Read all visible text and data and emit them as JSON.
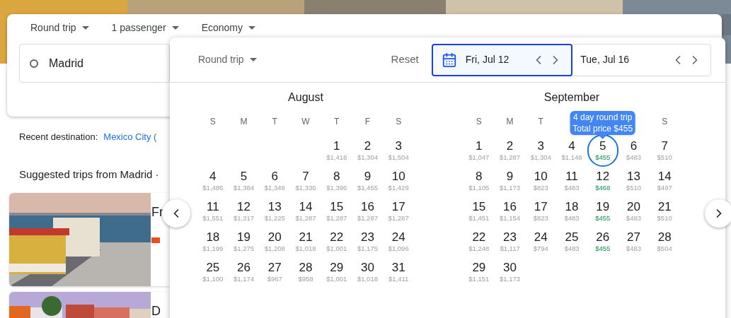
{
  "search_options": [
    {
      "label": "Round trip"
    },
    {
      "label": "1 passenger"
    },
    {
      "label": "Economy"
    }
  ],
  "origin": {
    "value": "Madrid"
  },
  "recent": {
    "label": "Recent destination:",
    "link": "Mexico City ("
  },
  "suggested_heading": "Suggested trips from Madrid ·",
  "trips": [
    {
      "title": "Fr",
      "kind": "picture"
    },
    {
      "title": "D",
      "kind": "picture"
    }
  ],
  "date_picker": {
    "trip_type": "Round trip",
    "reset": "Reset",
    "dates": [
      {
        "label": "Fri, Jul 12",
        "selected": true
      },
      {
        "label": "Tue, Jul 16",
        "selected": false
      }
    ],
    "months": [
      {
        "name": "August",
        "weekdays": [
          {
            "label": "S",
            "kind": "weekday"
          },
          {
            "label": "M",
            "kind": "weekday"
          },
          {
            "label": "T",
            "kind": "weekday"
          },
          {
            "label": "W",
            "kind": "weekday"
          },
          {
            "label": "T",
            "kind": "weekday"
          },
          {
            "label": "F",
            "kind": "weekday"
          },
          {
            "label": "S",
            "kind": "weekday"
          }
        ],
        "weeks": [
          {
            "kind": "first_week",
            "days": [
              {
                "day": "1",
                "price": "$1,418",
                "cheap": false,
                "selected": false
              },
              {
                "day": "2",
                "price": "$1,304",
                "cheap": false,
                "selected": false
              },
              {
                "day": "3",
                "price": "$1,504",
                "cheap": false,
                "selected": false
              }
            ]
          },
          {
            "kind": "week",
            "days": [
              {
                "day": "4",
                "price": "$1,486",
                "cheap": false,
                "selected": false
              },
              {
                "day": "5",
                "price": "$1,384",
                "cheap": false,
                "selected": false
              },
              {
                "day": "6",
                "price": "$1,348",
                "cheap": false,
                "selected": false
              },
              {
                "day": "7",
                "price": "$1,336",
                "cheap": false,
                "selected": false
              },
              {
                "day": "8",
                "price": "$1,396",
                "cheap": false,
                "selected": false
              },
              {
                "day": "9",
                "price": "$1,455",
                "cheap": false,
                "selected": false
              },
              {
                "day": "10",
                "price": "$1,429",
                "cheap": false,
                "selected": false
              }
            ]
          },
          {
            "kind": "week",
            "days": [
              {
                "day": "11",
                "price": "$1,551",
                "cheap": false,
                "selected": false
              },
              {
                "day": "12",
                "price": "$1,317",
                "cheap": false,
                "selected": false
              },
              {
                "day": "13",
                "price": "$1,225",
                "cheap": false,
                "selected": false
              },
              {
                "day": "14",
                "price": "$1,287",
                "cheap": false,
                "selected": false
              },
              {
                "day": "15",
                "price": "$1,287",
                "cheap": false,
                "selected": false
              },
              {
                "day": "16",
                "price": "$1,287",
                "cheap": false,
                "selected": false
              },
              {
                "day": "17",
                "price": "$1,287",
                "cheap": false,
                "selected": false
              }
            ]
          },
          {
            "kind": "week",
            "days": [
              {
                "day": "18",
                "price": "$1,199",
                "cheap": false,
                "selected": false
              },
              {
                "day": "19",
                "price": "$1,275",
                "cheap": false,
                "selected": false
              },
              {
                "day": "20",
                "price": "$1,208",
                "cheap": false,
                "selected": false
              },
              {
                "day": "21",
                "price": "$1,018",
                "cheap": false,
                "selected": false
              },
              {
                "day": "22",
                "price": "$1,001",
                "cheap": false,
                "selected": false
              },
              {
                "day": "23",
                "price": "$1,175",
                "cheap": false,
                "selected": false
              },
              {
                "day": "24",
                "price": "$1,096",
                "cheap": false,
                "selected": false
              }
            ]
          },
          {
            "kind": "week",
            "days": [
              {
                "day": "25",
                "price": "$1,100",
                "cheap": false,
                "selected": false
              },
              {
                "day": "26",
                "price": "$1,174",
                "cheap": false,
                "selected": false
              },
              {
                "day": "27",
                "price": "$967",
                "cheap": false,
                "selected": false
              },
              {
                "day": "28",
                "price": "$958",
                "cheap": false,
                "selected": false
              },
              {
                "day": "29",
                "price": "$1,001",
                "cheap": false,
                "selected": false
              },
              {
                "day": "30",
                "price": "$1,018",
                "cheap": false,
                "selected": false
              },
              {
                "day": "31",
                "price": "$1,411",
                "cheap": false,
                "selected": false
              }
            ]
          }
        ]
      },
      {
        "name": "September",
        "weekdays": [
          {
            "label": "S",
            "kind": "weekday"
          },
          {
            "label": "M",
            "kind": "weekday"
          },
          {
            "label": "T",
            "kind": "weekday"
          },
          {
            "label": "S",
            "kind": "last_column"
          }
        ],
        "tooltip": [
          "4 day round trip",
          "Total price $455"
        ],
        "weeks": [
          {
            "kind": "week",
            "days": [
              {
                "day": "1",
                "price": "$1,047",
                "cheap": false,
                "selected": false
              },
              {
                "day": "2",
                "price": "$1,287",
                "cheap": false,
                "selected": false
              },
              {
                "day": "3",
                "price": "$1,304",
                "cheap": false,
                "selected": false
              },
              {
                "day": "4",
                "price": "$1,148",
                "cheap": false,
                "selected": false
              },
              {
                "day": "5",
                "price": "$455",
                "cheap": true,
                "selected": true
              },
              {
                "day": "6",
                "price": "$483",
                "cheap": false,
                "selected": false
              },
              {
                "day": "7",
                "price": "$510",
                "cheap": false,
                "selected": false
              }
            ]
          },
          {
            "kind": "week",
            "days": [
              {
                "day": "8",
                "price": "$1,105",
                "cheap": false,
                "selected": false
              },
              {
                "day": "9",
                "price": "$1,173",
                "cheap": false,
                "selected": false
              },
              {
                "day": "10",
                "price": "$823",
                "cheap": false,
                "selected": false
              },
              {
                "day": "11",
                "price": "$483",
                "cheap": false,
                "selected": false
              },
              {
                "day": "12",
                "price": "$468",
                "cheap": true,
                "selected": false
              },
              {
                "day": "13",
                "price": "$510",
                "cheap": false,
                "selected": false
              },
              {
                "day": "14",
                "price": "$497",
                "cheap": false,
                "selected": false
              }
            ]
          },
          {
            "kind": "week",
            "days": [
              {
                "day": "15",
                "price": "$1,451",
                "cheap": false,
                "selected": false
              },
              {
                "day": "16",
                "price": "$1,154",
                "cheap": false,
                "selected": false
              },
              {
                "day": "17",
                "price": "$823",
                "cheap": false,
                "selected": false
              },
              {
                "day": "18",
                "price": "$483",
                "cheap": false,
                "selected": false
              },
              {
                "day": "19",
                "price": "$455",
                "cheap": true,
                "selected": false
              },
              {
                "day": "20",
                "price": "$483",
                "cheap": false,
                "selected": false
              },
              {
                "day": "21",
                "price": "$510",
                "cheap": false,
                "selected": false
              }
            ]
          },
          {
            "kind": "week",
            "days": [
              {
                "day": "22",
                "price": "$1,248",
                "cheap": false,
                "selected": false
              },
              {
                "day": "23",
                "price": "$1,117",
                "cheap": false,
                "selected": false
              },
              {
                "day": "24",
                "price": "$794",
                "cheap": false,
                "selected": false
              },
              {
                "day": "25",
                "price": "$483",
                "cheap": false,
                "selected": false
              },
              {
                "day": "26",
                "price": "$455",
                "cheap": true,
                "selected": false
              },
              {
                "day": "27",
                "price": "$483",
                "cheap": false,
                "selected": false
              },
              {
                "day": "28",
                "price": "$504",
                "cheap": false,
                "selected": false
              }
            ]
          },
          {
            "kind": "week",
            "days": [
              {
                "day": "29",
                "price": "$1,151",
                "cheap": false,
                "selected": false
              },
              {
                "day": "30",
                "price": "$1,173",
                "cheap": false,
                "selected": false
              }
            ]
          }
        ]
      }
    ]
  }
}
